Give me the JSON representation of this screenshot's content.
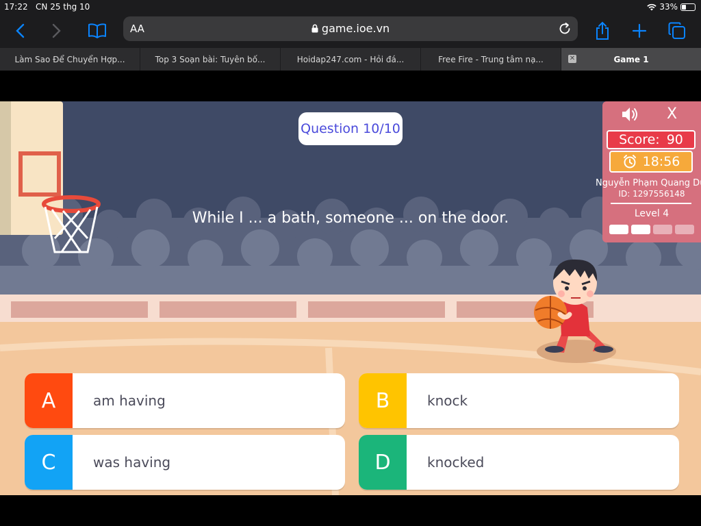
{
  "status_bar": {
    "time": "17:22",
    "date": "CN 25 thg 10",
    "battery": "33%",
    "battery_level": 0.33
  },
  "toolbar": {
    "aa": "AA",
    "url": "game.ioe.vn"
  },
  "tabs": [
    {
      "label": "Làm Sao Để Chuyển Hợp..."
    },
    {
      "label": "Top 3 Soạn bài: Tuyên bố..."
    },
    {
      "label": "Hoidap247.com - Hỏi đá..."
    },
    {
      "label": "Free Fire - Trung tâm nạ..."
    },
    {
      "label": "Game 1"
    }
  ],
  "game": {
    "question_counter": "Question 10/10",
    "question": "While I ... a bath, someone ... on the door.",
    "panel": {
      "close": "X",
      "score_label": "Score:",
      "score": "90",
      "timer": "18:56",
      "player_name": "Nguyễn Phạm Quang Du",
      "player_id": "ID: 1297556148",
      "level": "Level 4",
      "level_progress": {
        "completed": 2,
        "total": 4
      }
    },
    "answers": [
      {
        "letter": "A",
        "text": "am having",
        "color": "#ff4a10"
      },
      {
        "letter": "B",
        "text": "knock",
        "color": "#ffc400"
      },
      {
        "letter": "C",
        "text": "was having",
        "color": "#12a3f5"
      },
      {
        "letter": "D",
        "text": "knocked",
        "color": "#1bb57a"
      }
    ]
  }
}
